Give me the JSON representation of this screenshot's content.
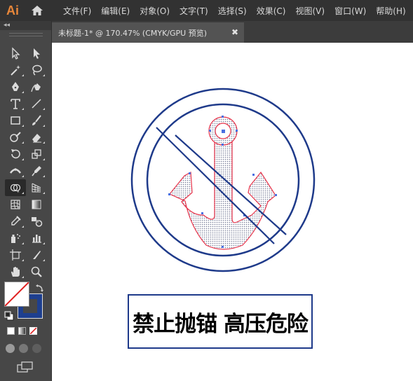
{
  "app": {
    "logo": "Ai"
  },
  "menu": [
    "文件(F)",
    "编辑(E)",
    "对象(O)",
    "文字(T)",
    "选择(S)",
    "效果(C)",
    "视图(V)",
    "窗口(W)",
    "帮助(H)"
  ],
  "tab": {
    "title": "未标题-1* @ 170.47% (CMYK/GPU 预览)",
    "close": "✖"
  },
  "toolbar": {
    "collapse": "◂◂",
    "tools": [
      "selection-tool",
      "direct-selection-tool",
      "magic-wand-tool",
      "lasso-tool",
      "pen-tool",
      "curvature-tool",
      "type-tool",
      "line-segment-tool",
      "rectangle-tool",
      "paintbrush-tool",
      "shaper-tool",
      "eraser-tool",
      "rotate-tool",
      "scale-tool",
      "width-tool",
      "puppet-warp-tool",
      "shape-builder-tool",
      "perspective-grid-tool",
      "mesh-tool",
      "gradient-tool",
      "eyedropper-tool",
      "blend-tool",
      "symbol-sprayer-tool",
      "column-graph-tool",
      "artboard-tool",
      "slice-tool",
      "hand-tool",
      "zoom-tool"
    ],
    "active_tool": "shape-builder-tool",
    "fill": "none",
    "stroke_color": "#1e3f8f"
  },
  "artwork": {
    "sign_text": "禁止抛锚 高压危险",
    "stroke_color": "#1e3a8a",
    "selection_color": "#e8334a"
  }
}
